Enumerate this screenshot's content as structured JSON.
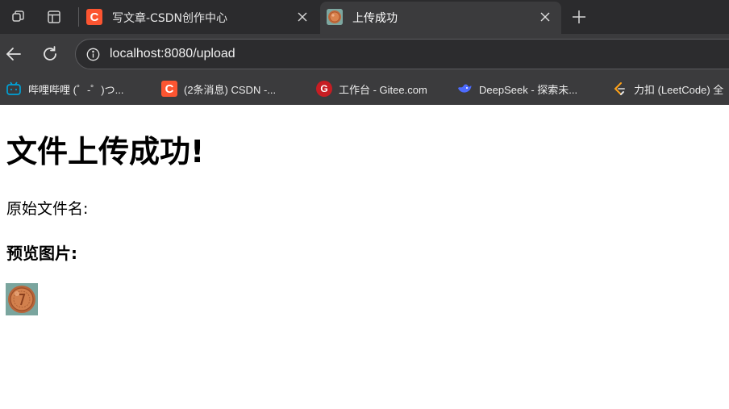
{
  "browser": {
    "tabs": [
      {
        "title": "写文章-CSDN创作中心",
        "favicon": "csdn-icon",
        "active": false
      },
      {
        "title": "上传成功",
        "favicon": "coin-image-icon",
        "active": true
      }
    ],
    "close_glyph": "✕",
    "newtab_glyph": "+",
    "url": "localhost:8080/upload",
    "bookmarks": [
      {
        "label": "哔哩哔哩 (゜-゜)つ...",
        "icon": "bilibili-icon"
      },
      {
        "label": "(2条消息) CSDN -...",
        "icon": "csdn-icon"
      },
      {
        "label": "工作台 - Gitee.com",
        "icon": "gitee-icon"
      },
      {
        "label": "DeepSeek - 探索未...",
        "icon": "deepseek-icon"
      },
      {
        "label": "力扣 (LeetCode) 全",
        "icon": "leetcode-icon"
      }
    ],
    "colors": {
      "tabstrip": "#2b2b2d",
      "toolbar": "#3b3b3d",
      "csdn": "#fc5531",
      "gitee": "#c71d23",
      "deepseek": "#4d6bfe",
      "bilibili": "#00a1d6"
    }
  },
  "page": {
    "heading": "文件上传成功!",
    "original_filename_label": "原始文件名:",
    "preview_heading": "预览图片:",
    "preview_image": "copper-coin-image"
  }
}
